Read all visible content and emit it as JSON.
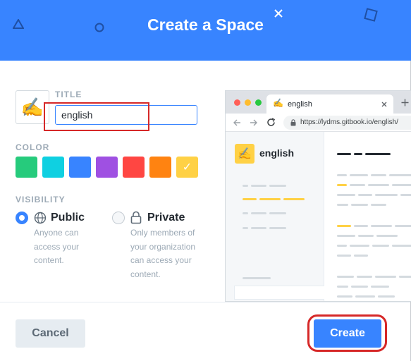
{
  "header": {
    "title": "Create a Space",
    "bg_color": "#3884ff"
  },
  "emoji": "✍️",
  "title_section": {
    "label": "TITLE",
    "value": "english",
    "placeholder": ""
  },
  "color_section": {
    "label": "COLOR",
    "swatches": [
      "#26cb7c",
      "#0fd0e1",
      "#3884ff",
      "#9f50e2",
      "#ff4642",
      "#ff8311",
      "#ffd145"
    ],
    "selected_index": 6
  },
  "visibility_section": {
    "label": "VISIBILITY",
    "options": [
      {
        "label": "Public",
        "desc_lines": [
          "Anyone can",
          "access your",
          "content."
        ],
        "selected": true,
        "icon": "globe-icon"
      },
      {
        "label": "Private",
        "desc_lines": [
          "Only members of",
          "your organization",
          "can access your",
          "content."
        ],
        "selected": false,
        "icon": "lock-icon"
      }
    ]
  },
  "preview": {
    "tab_label": "english",
    "url": "https://lydms.gitbook.io/english/",
    "space_name": "english"
  },
  "footer": {
    "cancel_label": "Cancel",
    "create_label": "Create"
  },
  "annotation_color": "#d62828"
}
